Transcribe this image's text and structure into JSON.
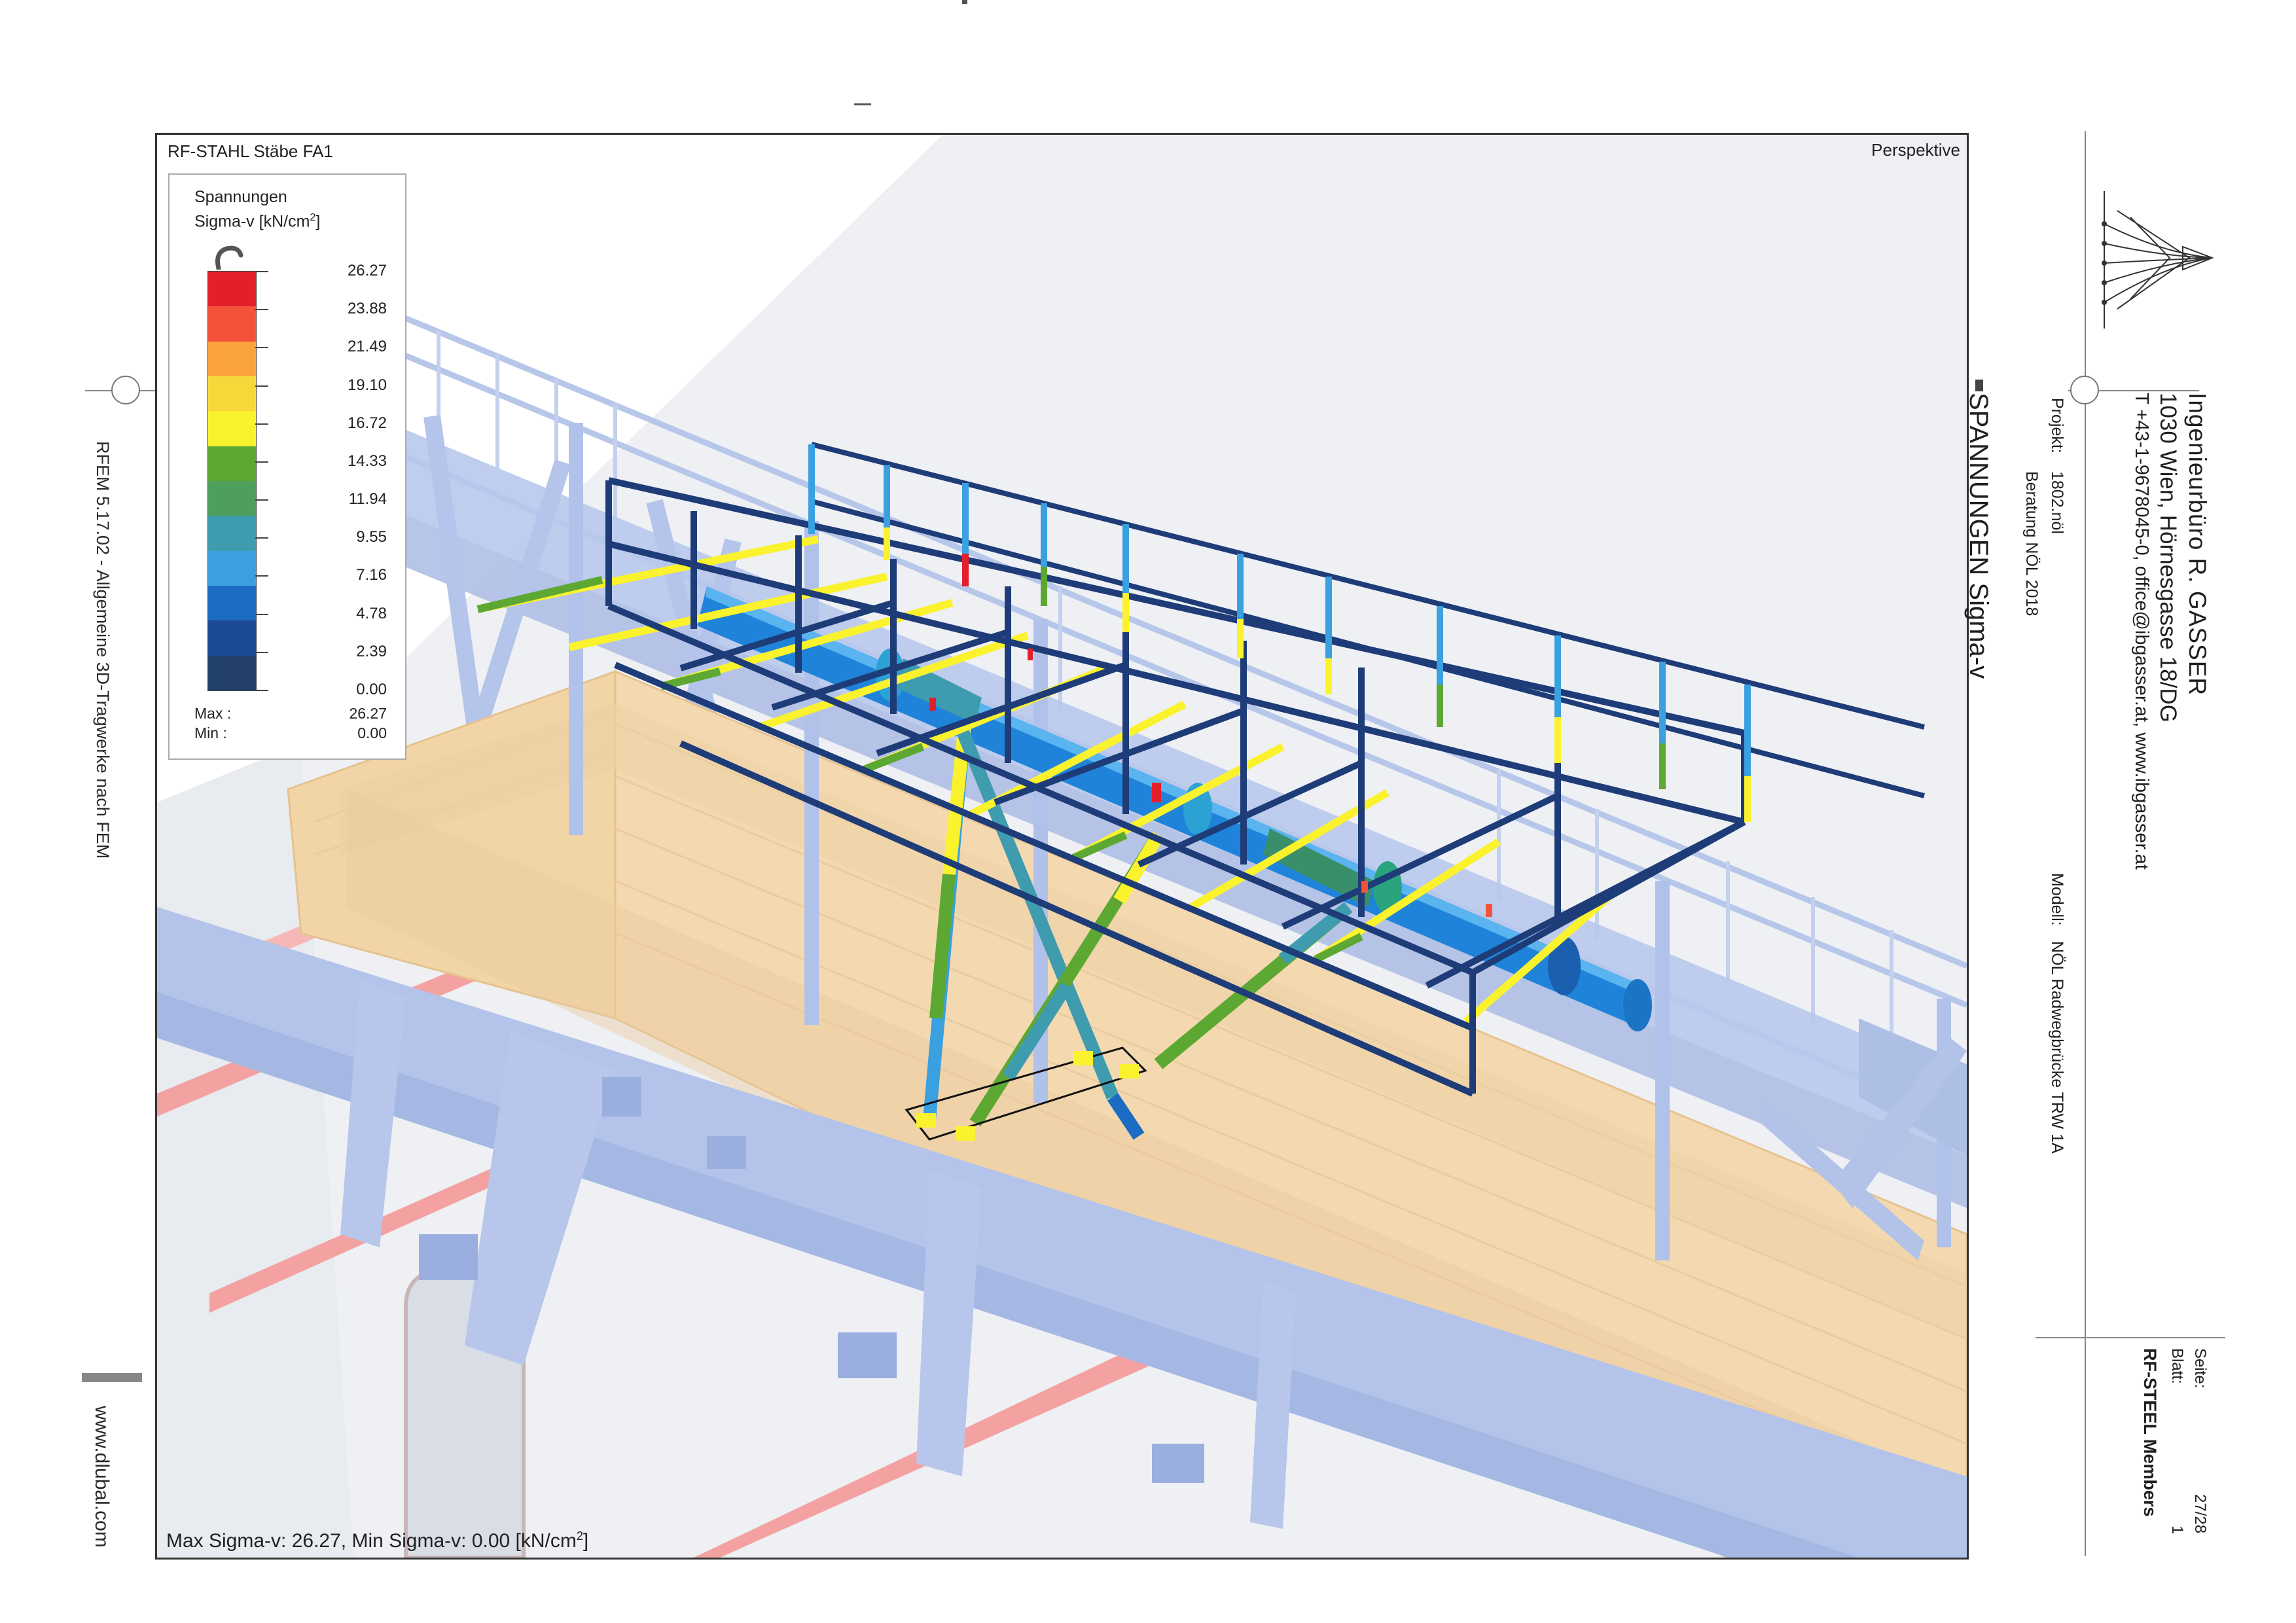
{
  "frame": {
    "title": "RF-STAHL Stäbe FA1",
    "view": "Perspektive",
    "footer_prefix": "Max Sigma-v: 26.27, Min Sigma-v: 0.00 [kN/cm",
    "footer_sup": "2",
    "footer_suffix": "]"
  },
  "legend": {
    "title_line1": "Spannungen",
    "title_line2_prefix": "Sigma-v [kN/cm",
    "title_line2_sup": "2",
    "title_line2_suffix": "]",
    "tick_labels": [
      "26.27",
      "23.88",
      "21.49",
      "19.10",
      "16.72",
      "14.33",
      "11.94",
      "9.55",
      "7.16",
      "4.78",
      "2.39",
      "0.00"
    ],
    "colors": [
      "#e41f2c",
      "#f35439",
      "#fba33f",
      "#f6d83a",
      "#fbf22e",
      "#5ca832",
      "#4e9f5b",
      "#3f9cae",
      "#3aa0e0",
      "#1c6cc3",
      "#1d4a94",
      "#22406a"
    ],
    "max_label": "Max :",
    "max_value": "26.27",
    "min_label": "Min :",
    "min_value": "0.00"
  },
  "title_block": {
    "company": "Ingenieurbüro R. GASSER",
    "address": "1030 Wien, Hörnesgasse 18/DG",
    "contact": "T +43-1-9678045-0, office@ibgasser.at,  www.ibgasser.at",
    "sheet_title": "SPANNUNGEN Sigma-v",
    "project_label": "Projekt:",
    "project_value": "1802.nöl",
    "project_desc": "Beratung NÖL 2018",
    "model_label": "Modell:",
    "model_value": "NÖL Radwegbrücke TRW 1A",
    "page_label": "Seite:",
    "page_value": "27/28",
    "sheet_label": "Blatt:",
    "sheet_value": "1",
    "module": "RF-STEEL Members"
  },
  "left_margin": {
    "software": "RFEM 5.17.02 - Allgemeine 3D-Tragwerke nach FEM",
    "website": "www.dlubal.com"
  }
}
